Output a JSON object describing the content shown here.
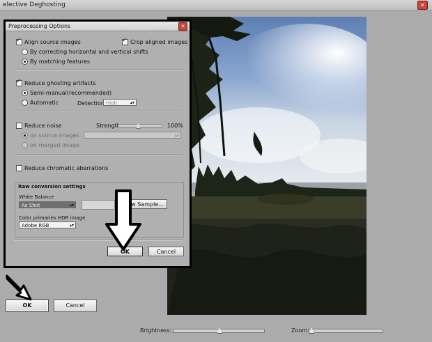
{
  "window": {
    "title": "elective Deghosting",
    "close_icon": "close-icon"
  },
  "dialog": {
    "title": "Preprocessing Options",
    "align": {
      "label": "Align source images",
      "checked": true,
      "option_shifts": "By correcting horizontal and vertical shifts",
      "option_features": "By matching features",
      "selected": "features"
    },
    "crop": {
      "label": "Crop aligned images",
      "checked": true
    },
    "ghosting": {
      "label": "Reduce ghosting artifacts",
      "checked": true,
      "semi_manual": "Semi-manual",
      "recommended": "(recommended)",
      "automatic": "Automatic",
      "detection_label": "Detection:",
      "detection_value": "High"
    },
    "noise": {
      "label": "Reduce noise",
      "checked": false,
      "strength_label": "Strength",
      "strength_value": "100%",
      "strength_level": 0.4,
      "on_source": "on source images",
      "on_merged": "on merged image",
      "select_value": ""
    },
    "chromatic": {
      "label": "Reduce chromatic aberrations",
      "checked": false
    },
    "raw": {
      "title": "Raw conversion settings",
      "white_balance_label": "White Balance",
      "white_balance_value": "As Shot",
      "sample_button": "w Sample...",
      "color_primaries_label": "Color primaries HDR image",
      "color_primaries_value": "Adobe RGB"
    },
    "ok_label": "OK",
    "cancel_label": "Cancel"
  },
  "outer": {
    "ok_label": "OK",
    "cancel_label": "Cancel",
    "brightness_label": "Brightness:",
    "zoom_label": "Zoom:",
    "brightness_level": 0.5,
    "zoom_level": 0.0
  }
}
